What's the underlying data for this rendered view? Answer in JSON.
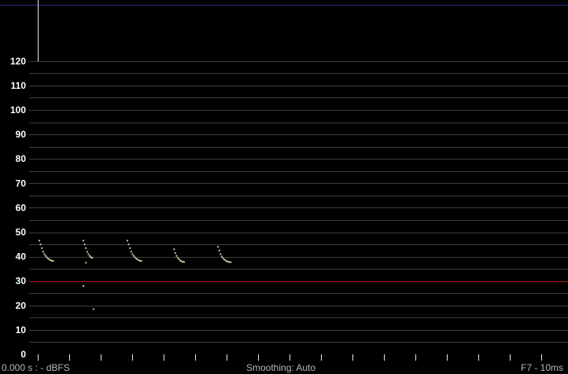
{
  "colors": {
    "background": "#000000",
    "grid": "#3c3c3c",
    "tick_label": "#ffffff",
    "threshold": "#b01818",
    "top_rule": "#2a2a8c",
    "cursor": "#e8e8e8",
    "trace": "#c8c8a0",
    "status_text": "#b8b8b8"
  },
  "status": {
    "left": "0.000 s : - dBFS",
    "center": "Smoothing: Auto",
    "right": "F7 - 10ms"
  },
  "chart_data": {
    "type": "scatter",
    "ylim": [
      0,
      125
    ],
    "yticks": [
      0,
      10,
      20,
      30,
      40,
      50,
      60,
      70,
      80,
      90,
      100,
      110,
      120
    ],
    "threshold": 30,
    "grid": true,
    "series": [
      {
        "points": [
          [
            0,
            46.5
          ],
          [
            1,
            45
          ],
          [
            2,
            43.5
          ],
          [
            3,
            42
          ],
          [
            4,
            41
          ],
          [
            5,
            40.3
          ],
          [
            6,
            39.7
          ],
          [
            7,
            39.2
          ],
          [
            8,
            38.8
          ],
          [
            9,
            38.5
          ],
          [
            10,
            38.3
          ],
          [
            11,
            38.2
          ],
          [
            35,
            46.5
          ],
          [
            36,
            45
          ],
          [
            37,
            43.5
          ],
          [
            38,
            42
          ],
          [
            39,
            41
          ],
          [
            40,
            40.3
          ],
          [
            41,
            39.8
          ],
          [
            42,
            39.5
          ],
          [
            37,
            37.5
          ],
          [
            35,
            28
          ],
          [
            43,
            18.5
          ],
          [
            70,
            46.5
          ],
          [
            71,
            45
          ],
          [
            72,
            43.5
          ],
          [
            73,
            42
          ],
          [
            74,
            41
          ],
          [
            75,
            40.3
          ],
          [
            76,
            39.7
          ],
          [
            77,
            39.2
          ],
          [
            78,
            38.8
          ],
          [
            79,
            38.5
          ],
          [
            80,
            38.3
          ],
          [
            81,
            38.2
          ],
          [
            107,
            43
          ],
          [
            108,
            41.5
          ],
          [
            109,
            40.3
          ],
          [
            110,
            39.5
          ],
          [
            111,
            38.9
          ],
          [
            112,
            38.4
          ],
          [
            113,
            38.1
          ],
          [
            114,
            37.9
          ],
          [
            115,
            37.8
          ],
          [
            142,
            44
          ],
          [
            143,
            42.5
          ],
          [
            144,
            41
          ],
          [
            145,
            40
          ],
          [
            146,
            39.3
          ],
          [
            147,
            38.8
          ],
          [
            148,
            38.4
          ],
          [
            149,
            38.1
          ],
          [
            150,
            37.9
          ],
          [
            151,
            37.8
          ],
          [
            152,
            37.7
          ]
        ]
      }
    ]
  }
}
